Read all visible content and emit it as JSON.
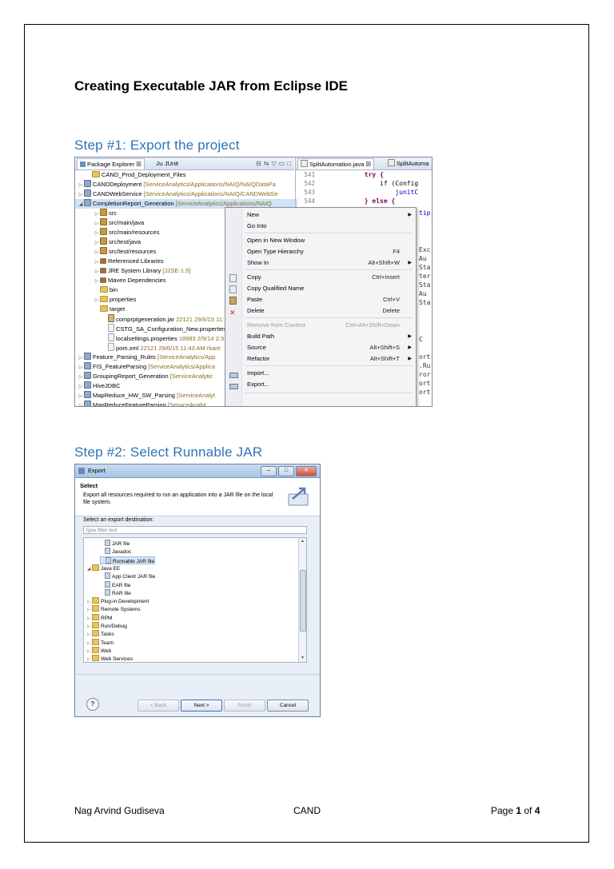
{
  "title": "Creating Executable JAR from Eclipse IDE",
  "step1": {
    "heading": "Step #1: Export the project",
    "tabs": {
      "package_explorer": "Package Explorer",
      "junit": "JUnit"
    },
    "editor_tabs": [
      "SplitAutomation.java",
      "SplitAutoma"
    ],
    "tree": [
      {
        "label": "CAND_Prod_Deployment_Files",
        "deco": ""
      },
      {
        "label": "CANDDeployment",
        "deco": "[ServiceAnalytics/Applications/NAIQ/NAIQDataPa"
      },
      {
        "label": "CANDWebService",
        "deco": "[ServiceAnalytics/Applications/NAIQ/CANDWebSe"
      },
      {
        "label": "CompletionReport_Generation",
        "deco": "[ServiceAnalytics/Applications/NAIQ"
      },
      {
        "label": "src",
        "deco": ""
      },
      {
        "label": "src/main/java",
        "deco": ""
      },
      {
        "label": "src/main/resources",
        "deco": ""
      },
      {
        "label": "src/test/java",
        "deco": ""
      },
      {
        "label": "src/test/resources",
        "deco": ""
      },
      {
        "label": "Referenced Libraries",
        "deco": ""
      },
      {
        "label": "JRE System Library",
        "deco": "[J2SE-1.5]"
      },
      {
        "label": "Maven Dependencies",
        "deco": ""
      },
      {
        "label": "bin",
        "deco": ""
      },
      {
        "label": "properties",
        "deco": ""
      },
      {
        "label": "target",
        "deco": ""
      },
      {
        "label": "comprptgeneration.jar",
        "deco": "22121  29/6/15 11:"
      },
      {
        "label": "CSTG_SA_Configuration_New.properties",
        "deco": ""
      },
      {
        "label": "localsettings.properties",
        "deco": "18983  2/9/14 2:3"
      },
      {
        "label": "pom.xml",
        "deco": "22121  29/6/15 11:43 AM  rkant"
      },
      {
        "label": "Feature_Parsing_Rules",
        "deco": "[ServiceAnalytics/App"
      },
      {
        "label": "FIS_FeatureParsing",
        "deco": "[ServiceAnalytics/Applica"
      },
      {
        "label": "GroupingReport_Generation",
        "deco": "[ServiceAnalytic"
      },
      {
        "label": "HiveJDBC",
        "deco": ""
      },
      {
        "label": "MapReduce_HW_SW_Parsing",
        "deco": "[ServiceAnalyt"
      },
      {
        "label": "MapReduceFeatureParsing",
        "deco": "[ServiceAnalyt"
      }
    ],
    "code": [
      {
        "ln": "541",
        "text": "            try {"
      },
      {
        "ln": "542",
        "text": "                if (Config"
      },
      {
        "ln": "543",
        "text": "                    junitC"
      },
      {
        "ln": "544",
        "text": "            } else {"
      }
    ],
    "menu": [
      {
        "label": "New",
        "shortcut": "",
        "submenu": true,
        "disabled": false,
        "icon": ""
      },
      {
        "label": "Go Into",
        "shortcut": "",
        "submenu": false,
        "disabled": false,
        "icon": ""
      },
      {
        "label": "Open in New Window",
        "shortcut": "",
        "submenu": false,
        "disabled": false,
        "icon": ""
      },
      {
        "label": "Open Type Hierarchy",
        "shortcut": "F4",
        "submenu": false,
        "disabled": false,
        "icon": ""
      },
      {
        "label": "Show In",
        "shortcut": "Alt+Shift+W",
        "submenu": true,
        "disabled": false,
        "icon": ""
      },
      {
        "label": "Copy",
        "shortcut": "Ctrl+Insert",
        "submenu": false,
        "disabled": false,
        "icon": "copy-icon"
      },
      {
        "label": "Copy Qualified Name",
        "shortcut": "",
        "submenu": false,
        "disabled": false,
        "icon": "copy-icon"
      },
      {
        "label": "Paste",
        "shortcut": "Ctrl+V",
        "submenu": false,
        "disabled": false,
        "icon": "paste-icon"
      },
      {
        "label": "Delete",
        "shortcut": "Delete",
        "submenu": false,
        "disabled": false,
        "icon": "delete-icon"
      },
      {
        "label": "Remove from Context",
        "shortcut": "Ctrl+Alt+Shift+Down",
        "submenu": false,
        "disabled": true,
        "icon": ""
      },
      {
        "label": "Build Path",
        "shortcut": "",
        "submenu": true,
        "disabled": false,
        "icon": ""
      },
      {
        "label": "Source",
        "shortcut": "Alt+Shift+S",
        "submenu": true,
        "disabled": false,
        "icon": ""
      },
      {
        "label": "Refactor",
        "shortcut": "Alt+Shift+T",
        "submenu": true,
        "disabled": false,
        "icon": ""
      },
      {
        "label": "Import...",
        "shortcut": "",
        "submenu": false,
        "disabled": false,
        "icon": "import-icon"
      },
      {
        "label": "Export...",
        "shortcut": "",
        "submenu": false,
        "disabled": false,
        "icon": "export-icon"
      }
    ]
  },
  "step2": {
    "heading": "Step #2: Select Runnable JAR",
    "dialog_title": "Export",
    "banner_title": "Select",
    "banner_desc": "Export all resources required to run an application into a JAR file on the local file system.",
    "dest_label": "Select an export destination:",
    "filter_placeholder": "type filter text",
    "tree": [
      {
        "label": "JAR file",
        "type": "item",
        "level": 2,
        "sel": false,
        "tw": ""
      },
      {
        "label": "Javadoc",
        "type": "item",
        "level": 2,
        "sel": false,
        "tw": ""
      },
      {
        "label": "Runnable JAR file",
        "type": "item",
        "level": 2,
        "sel": true,
        "tw": ""
      },
      {
        "label": "Java EE",
        "type": "folder",
        "level": 1,
        "sel": false,
        "tw": "◢"
      },
      {
        "label": "App Client JAR file",
        "type": "item",
        "level": 2,
        "sel": false,
        "tw": ""
      },
      {
        "label": "EAR file",
        "type": "item",
        "level": 2,
        "sel": false,
        "tw": ""
      },
      {
        "label": "RAR file",
        "type": "item",
        "level": 2,
        "sel": false,
        "tw": ""
      },
      {
        "label": "Plug-in Development",
        "type": "folder",
        "level": 1,
        "sel": false,
        "tw": "▷"
      },
      {
        "label": "Remote Systems",
        "type": "folder",
        "level": 1,
        "sel": false,
        "tw": "▷"
      },
      {
        "label": "RPM",
        "type": "folder",
        "level": 1,
        "sel": false,
        "tw": "▷"
      },
      {
        "label": "Run/Debug",
        "type": "folder",
        "level": 1,
        "sel": false,
        "tw": "▷"
      },
      {
        "label": "Tasks",
        "type": "folder",
        "level": 1,
        "sel": false,
        "tw": "▷"
      },
      {
        "label": "Team",
        "type": "folder",
        "level": 1,
        "sel": false,
        "tw": "▷"
      },
      {
        "label": "Web",
        "type": "folder",
        "level": 1,
        "sel": false,
        "tw": "▷"
      },
      {
        "label": "Web Services",
        "type": "folder",
        "level": 1,
        "sel": false,
        "tw": "▷"
      }
    ],
    "buttons": {
      "help": "?",
      "back": "< Back",
      "next": "Next >",
      "finish": "Finish",
      "cancel": "Cancel"
    }
  },
  "footer": {
    "author": "Nag Arvind Gudiseva",
    "center": "CAND",
    "page_prefix": "Page ",
    "page_num": "1",
    "page_of": " of ",
    "page_total": "4"
  }
}
